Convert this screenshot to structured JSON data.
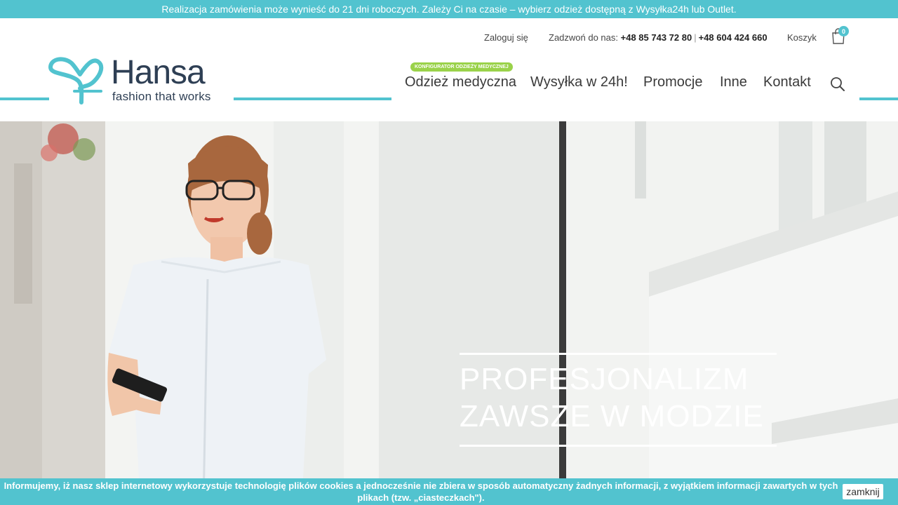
{
  "announcement": "Realizacja zamówienia może wynieść do 21 dni roboczych. Zależy Ci na czasie – wybierz odzież dostępną z Wysyłka24h lub Outlet.",
  "utility": {
    "login": "Zaloguj się",
    "phone_label": "Zadzwoń do nas:",
    "phone_1": "+48 85 743 72 80",
    "phone_sep": "|",
    "phone_2": "+48 604 424 660",
    "cart_label": "Koszyk",
    "cart_count": "0"
  },
  "logo": {
    "wordmark": "Hansa",
    "tagline": "fashion that works"
  },
  "nav": {
    "config_badge": "KONFIGURATOR ODZIEŻY MEDYCZNEJ",
    "items": [
      "Odzież medyczna",
      "Wysyłka w 24h!",
      "Promocje",
      "Inne",
      "Kontakt"
    ]
  },
  "hero": {
    "line1": "PROFESJONALIZM",
    "line2": "ZAWSZE W MODZIE"
  },
  "cookie": {
    "line1": "Informujemy, iż nasz sklep internetowy wykorzystuje technologię plików cookies a jednocześnie nie zbiera w sposób automatyczny żadnych informacji, z wyjątkiem informacji zawartych w tych",
    "line2": "plikach (tzw. „ciasteczkach\").",
    "close": "zamknij"
  },
  "colors": {
    "accent": "#52c3cf",
    "badge_green": "#9ad24a",
    "logo_navy": "#2e3f54"
  }
}
